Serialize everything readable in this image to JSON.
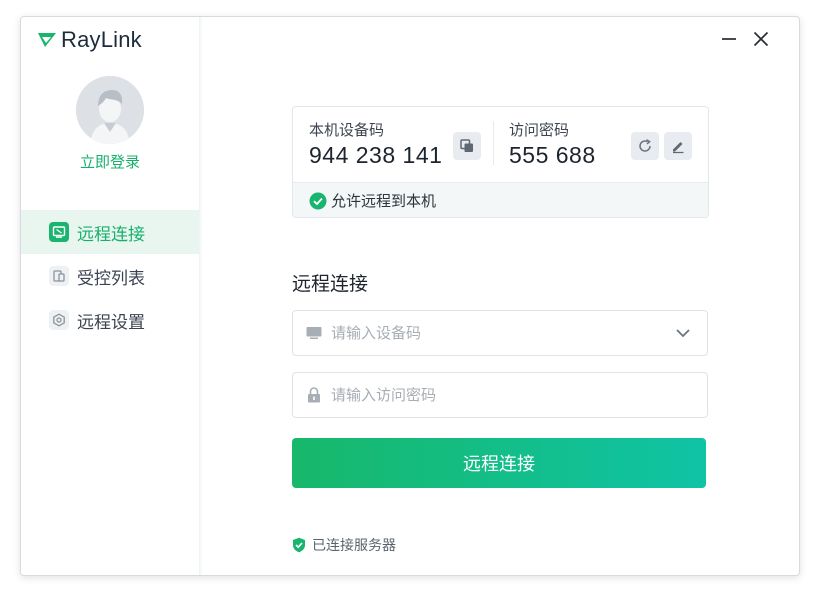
{
  "app": {
    "logo_text": "RayLink"
  },
  "sidebar": {
    "login_label": "立即登录",
    "items": [
      {
        "label": "远程连接",
        "icon": "remote-desktop-icon",
        "active": true
      },
      {
        "label": "受控列表",
        "icon": "device-list-icon",
        "active": false
      },
      {
        "label": "远程设置",
        "icon": "settings-hexagon-icon",
        "active": false
      }
    ]
  },
  "device_card": {
    "device_code_label": "本机设备码",
    "device_code_value": "944 238 141",
    "access_password_label": "访问密码",
    "access_password_value": "555 688",
    "allow_remote_label": "允许远程到本机"
  },
  "connect_form": {
    "title": "远程连接",
    "device_code_placeholder": "请输入设备码",
    "password_placeholder": "请输入访问密码",
    "connect_button_label": "远程连接"
  },
  "status": {
    "text": "已连接服务器"
  },
  "colors": {
    "accent": "#16b06b",
    "accent_gradient_end": "#0fc3a5"
  }
}
